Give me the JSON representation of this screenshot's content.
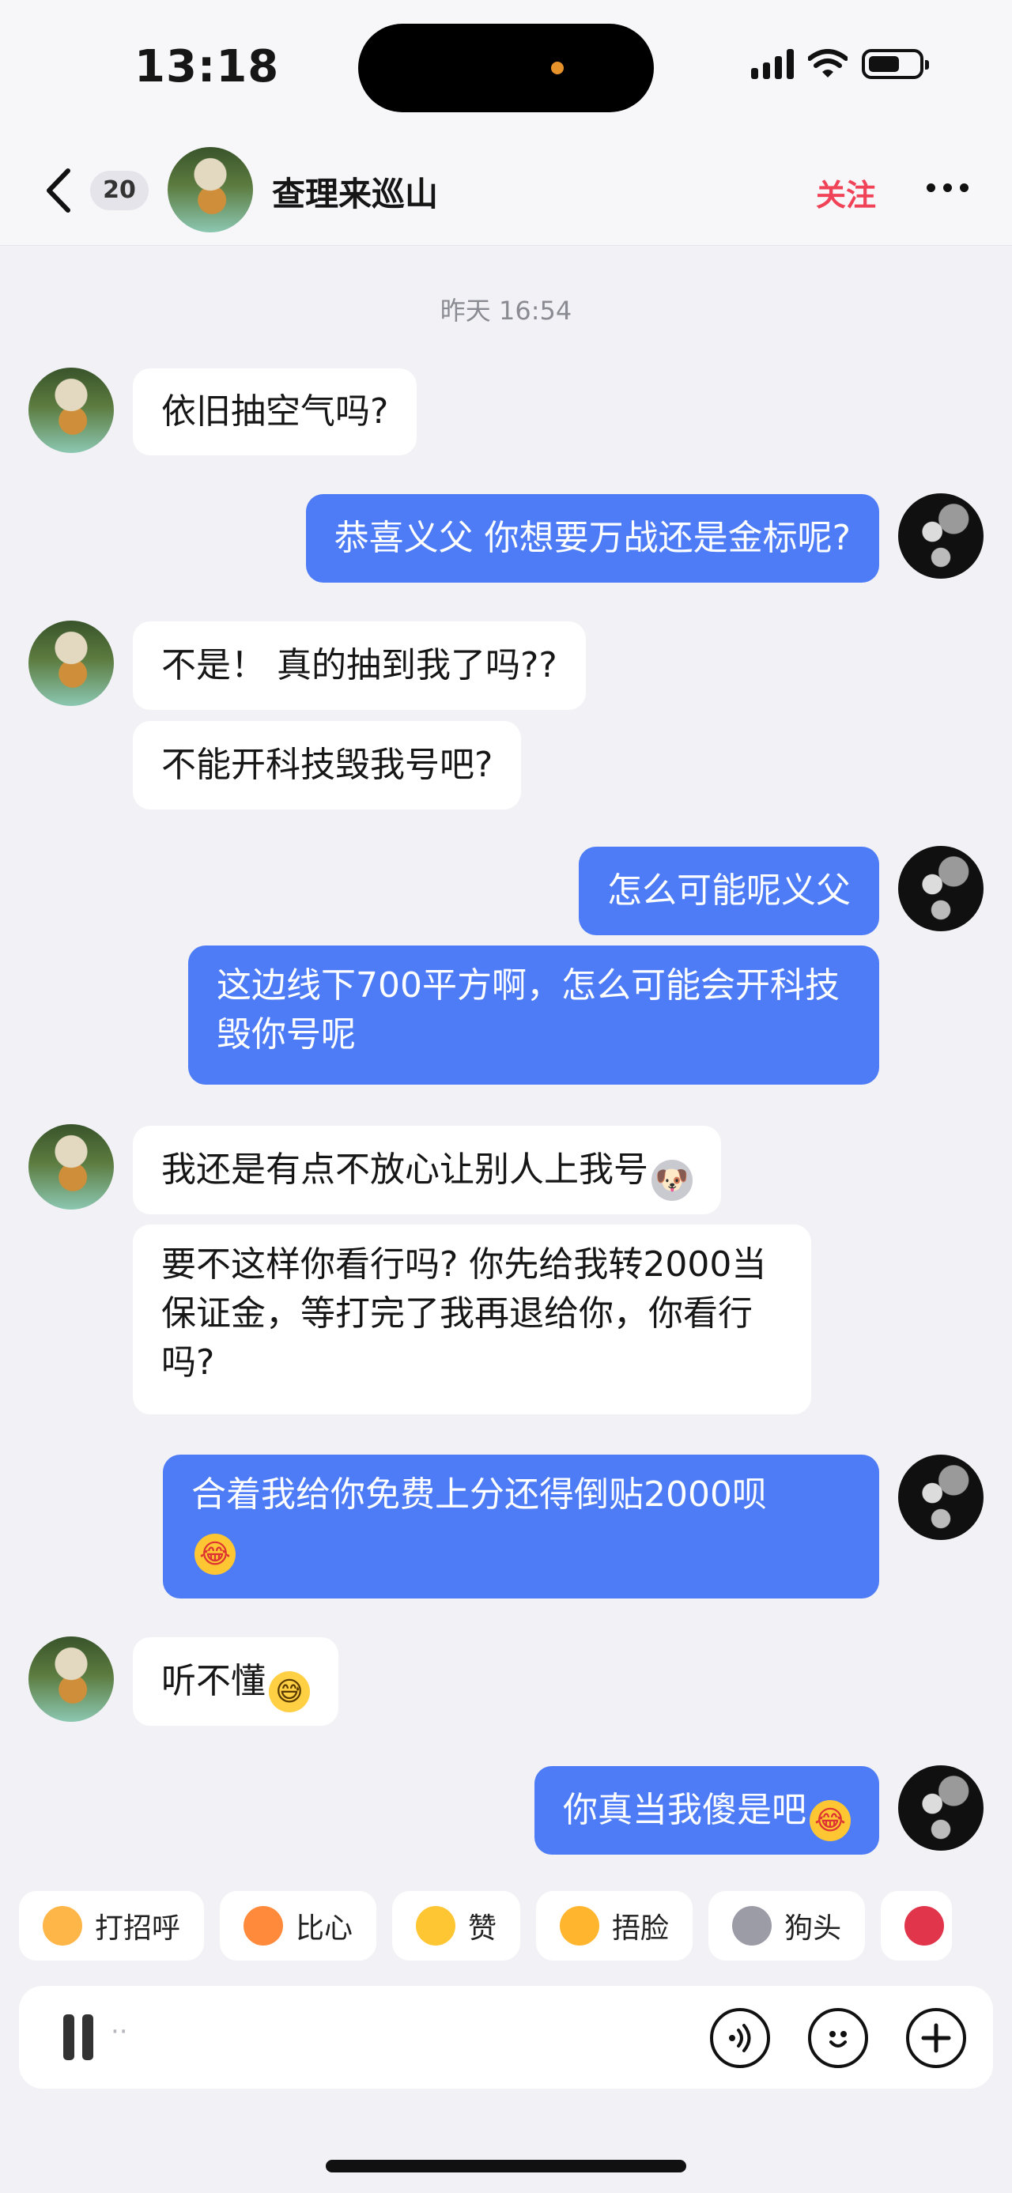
{
  "status_bar": {
    "time": "13:18"
  },
  "header": {
    "unread_count": "20",
    "contact_name": "查理来巡山",
    "follow_label": "关注"
  },
  "timestamp": "昨天 16:54",
  "messages": [
    {
      "from": "other",
      "text": "依旧抽空气吗?"
    },
    {
      "from": "me",
      "text": "恭喜义父 你想要万战还是金标呢?"
    },
    {
      "from": "other",
      "text": "不是！ 真的抽到我了吗??"
    },
    {
      "from": "other",
      "text": "不能开科技毁我号吧?"
    },
    {
      "from": "me",
      "text": "怎么可能呢义父"
    },
    {
      "from": "me",
      "text": "这边线下700平方啊，怎么可能会开科技毁你号呢"
    },
    {
      "from": "other",
      "text": "我还是有点不放心让别人上我号",
      "emoji": "dog-head-emoji"
    },
    {
      "from": "other",
      "text": "要不这样你看行吗? 你先给我转2000当保证金，等打完了我再退给你，你看行吗?"
    },
    {
      "from": "me",
      "text": "合着我给你免费上分还得倒贴2000呗",
      "emoji": "facepalm-emoji"
    },
    {
      "from": "other",
      "text": "听不懂",
      "emoji": "sweat-smile-emoji"
    },
    {
      "from": "me",
      "text": "你真当我傻是吧",
      "emoji": "facepalm-emoji"
    }
  ],
  "quick_replies": [
    {
      "label": "打招呼",
      "icon": "wave-emoji",
      "color": "#ffb648"
    },
    {
      "label": "比心",
      "icon": "heart-hands-emoji",
      "color": "#ff8a3c"
    },
    {
      "label": "赞",
      "icon": "thumbs-up-emoji",
      "color": "#ffc633"
    },
    {
      "label": "捂脸",
      "icon": "facepalm-emoji",
      "color": "#ffb62e"
    },
    {
      "label": "狗头",
      "icon": "dog-head-emoji",
      "color": "#9c9ca6"
    }
  ],
  "input": {
    "placeholder": "··"
  },
  "colors": {
    "accent_follow": "#f04358",
    "my_bubble": "#4e7cf7",
    "background": "#f2f2f6"
  }
}
